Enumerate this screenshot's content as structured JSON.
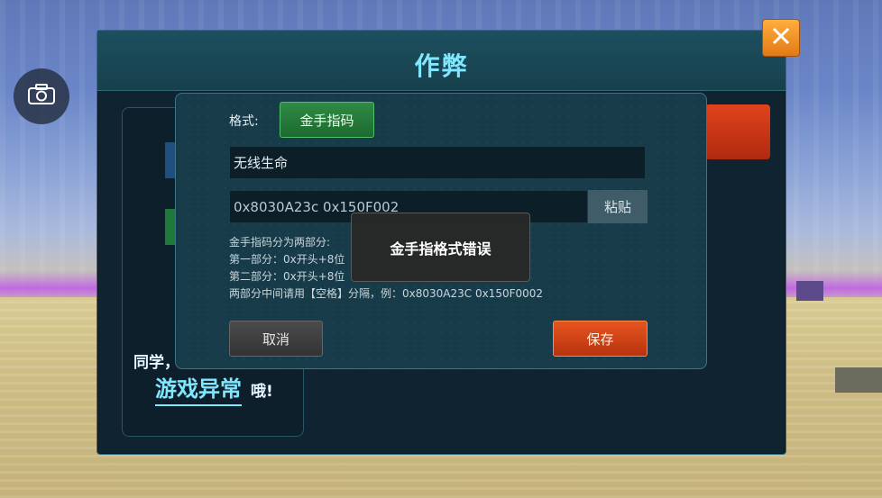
{
  "camera": {
    "icon": "camera-icon"
  },
  "panel": {
    "title": "作弊",
    "close_icon": "close-icon",
    "classmate_text": "同学，",
    "game_abnormal": "游戏异常",
    "oh_text": "哦!"
  },
  "dialog": {
    "format_label": "格式:",
    "format_value": "金手指码",
    "name_value": "无线生命",
    "code_value": "0x8030A23c 0x150F002",
    "paste_label": "粘贴",
    "help_lines": [
      "金手指码分为两部分:",
      "第一部分：0x开头+8位",
      "第二部分：0x开头+8位",
      "两部分中间请用【空格】分隔，例：0x8030A23C 0x150F0002"
    ],
    "cancel_label": "取消",
    "save_label": "保存"
  },
  "toast": {
    "message": "金手指格式错误"
  },
  "colors": {
    "accent": "#7fe8ff",
    "save": "#e6551f",
    "format_green": "#2f8a45",
    "close_orange": "#ffae3c"
  }
}
